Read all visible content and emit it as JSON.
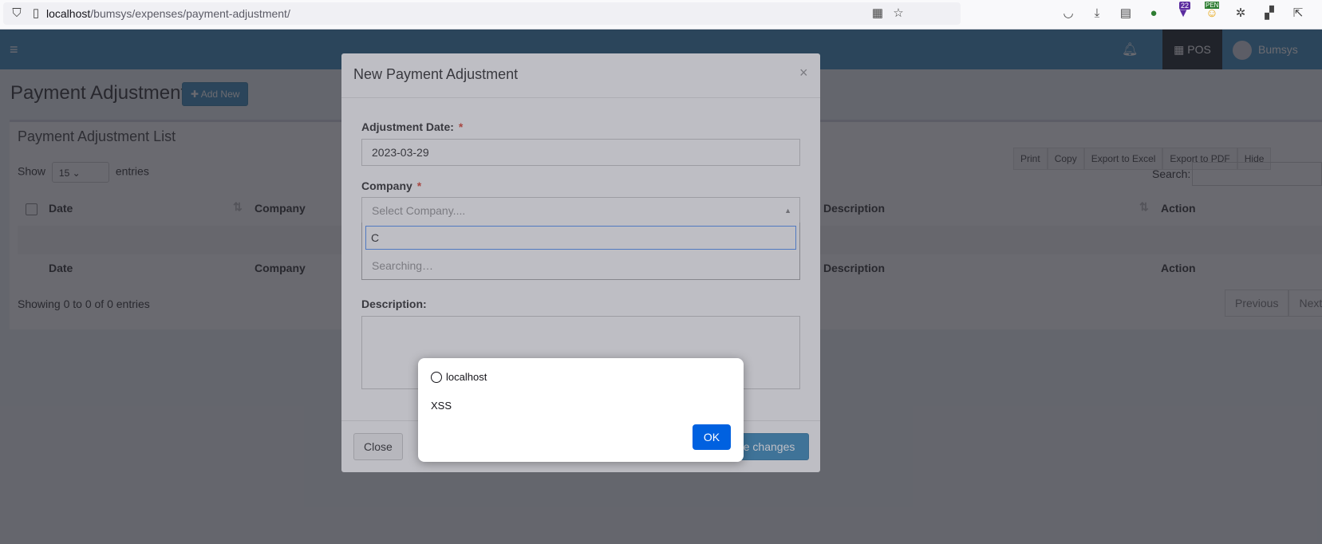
{
  "browser": {
    "url_host": "localhost",
    "url_path": "/bumsys/expenses/payment-adjustment/",
    "badge_count": "22",
    "badge_pen": "PEN"
  },
  "header": {
    "pos_label": "POS",
    "user_name": "Bumsys"
  },
  "page": {
    "title": "Payment Adjustment",
    "add_new_label": "Add New",
    "list_title": "Payment Adjustment List",
    "show_label": "Show",
    "entries_value": "15",
    "entries_label": "entries",
    "search_label": "Search:",
    "buttons": [
      "Print",
      "Copy",
      "Export to Excel",
      "Export to PDF",
      "Hide"
    ],
    "columns": {
      "date": "Date",
      "company": "Company",
      "description": "Description",
      "action": "Action"
    },
    "info": "Showing 0 to 0 of 0 entries",
    "prev": "Previous",
    "next": "Next"
  },
  "modal": {
    "title": "New Payment Adjustment",
    "close_x": "×",
    "date_label": "Adjustment Date:",
    "date_value": "2023-03-29",
    "company_label": "Company",
    "company_placeholder": "Select Company....",
    "search_value": "C",
    "searching_text": "Searching…",
    "description_label": "Description:",
    "close_label": "Close",
    "save_label": "Save changes"
  },
  "alert": {
    "origin": "localhost",
    "message": "XSS",
    "ok_label": "OK"
  },
  "colors": {
    "header_blue": "#3c8dbc",
    "ok_blue": "#0061e0",
    "required_red": "#dd4b39"
  }
}
